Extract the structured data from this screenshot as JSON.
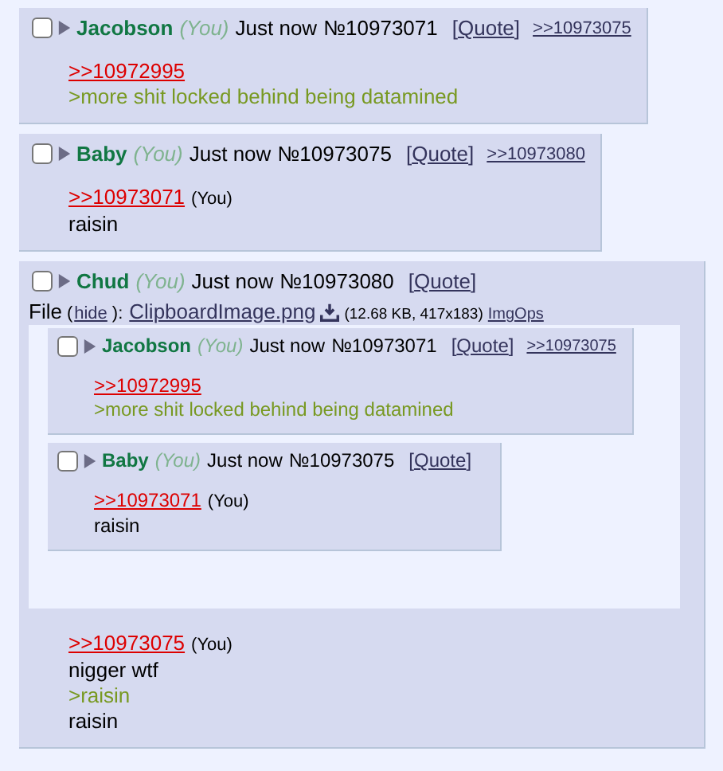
{
  "posts": [
    {
      "checked": false,
      "name": "Jacobson",
      "you": "(You)",
      "time": "Just now",
      "number": "№10973071",
      "quote_open": "[",
      "quote": "Quote",
      "quote_close": "]",
      "backlinks": [
        ">>10973075"
      ],
      "body": [
        {
          "kind": "quotelink",
          "text": ">>10972995"
        },
        {
          "kind": "greentext",
          "text": ">more shit locked behind being datamined"
        }
      ]
    },
    {
      "checked": false,
      "name": "Baby",
      "you": "(You)",
      "time": "Just now",
      "number": "№10973075",
      "quote_open": "[",
      "quote": "Quote",
      "quote_close": "]",
      "backlinks": [
        ">>10973080"
      ],
      "body": [
        {
          "kind": "quotelink",
          "text": ">>10973071",
          "you": "(You)"
        },
        {
          "kind": "text",
          "text": "raisin"
        }
      ]
    },
    {
      "checked": false,
      "name": "Chud",
      "you": "(You)",
      "time": "Just now",
      "number": "№10973080",
      "quote_open": "[",
      "quote": "Quote",
      "quote_close": "]",
      "file": {
        "label": "File",
        "hide_open": "(",
        "hide": "hide",
        "hide_close": "):",
        "filename": "ClipboardImage.png",
        "info": "(12.68 KB, 417x183)",
        "imgops": "ImgOps",
        "image_posts": [
          {
            "checked": false,
            "name": "Jacobson",
            "you": "(You)",
            "time": "Just now",
            "number": "№10973071",
            "quote_open": "[",
            "quote": "Quote",
            "quote_close": "]",
            "backlinks": [
              ">>10973075"
            ],
            "body": [
              {
                "kind": "quotelink",
                "text": ">>10972995"
              },
              {
                "kind": "greentext",
                "text": ">more shit locked behind being datamined"
              }
            ]
          },
          {
            "checked": false,
            "name": "Baby",
            "you": "(You)",
            "time": "Just now",
            "number": "№10973075",
            "quote_open": "[",
            "quote": "Quote",
            "quote_close": "]",
            "body": [
              {
                "kind": "quotelink",
                "text": ">>10973071",
                "you": "(You)"
              },
              {
                "kind": "text",
                "text": "raisin"
              }
            ]
          }
        ]
      },
      "body": [
        {
          "kind": "quotelink",
          "text": ">>10973075",
          "you": "(You)"
        },
        {
          "kind": "text",
          "text": "nigger wtf"
        },
        {
          "kind": "greentext",
          "text": ">raisin"
        },
        {
          "kind": "text",
          "text": "raisin"
        }
      ]
    }
  ]
}
